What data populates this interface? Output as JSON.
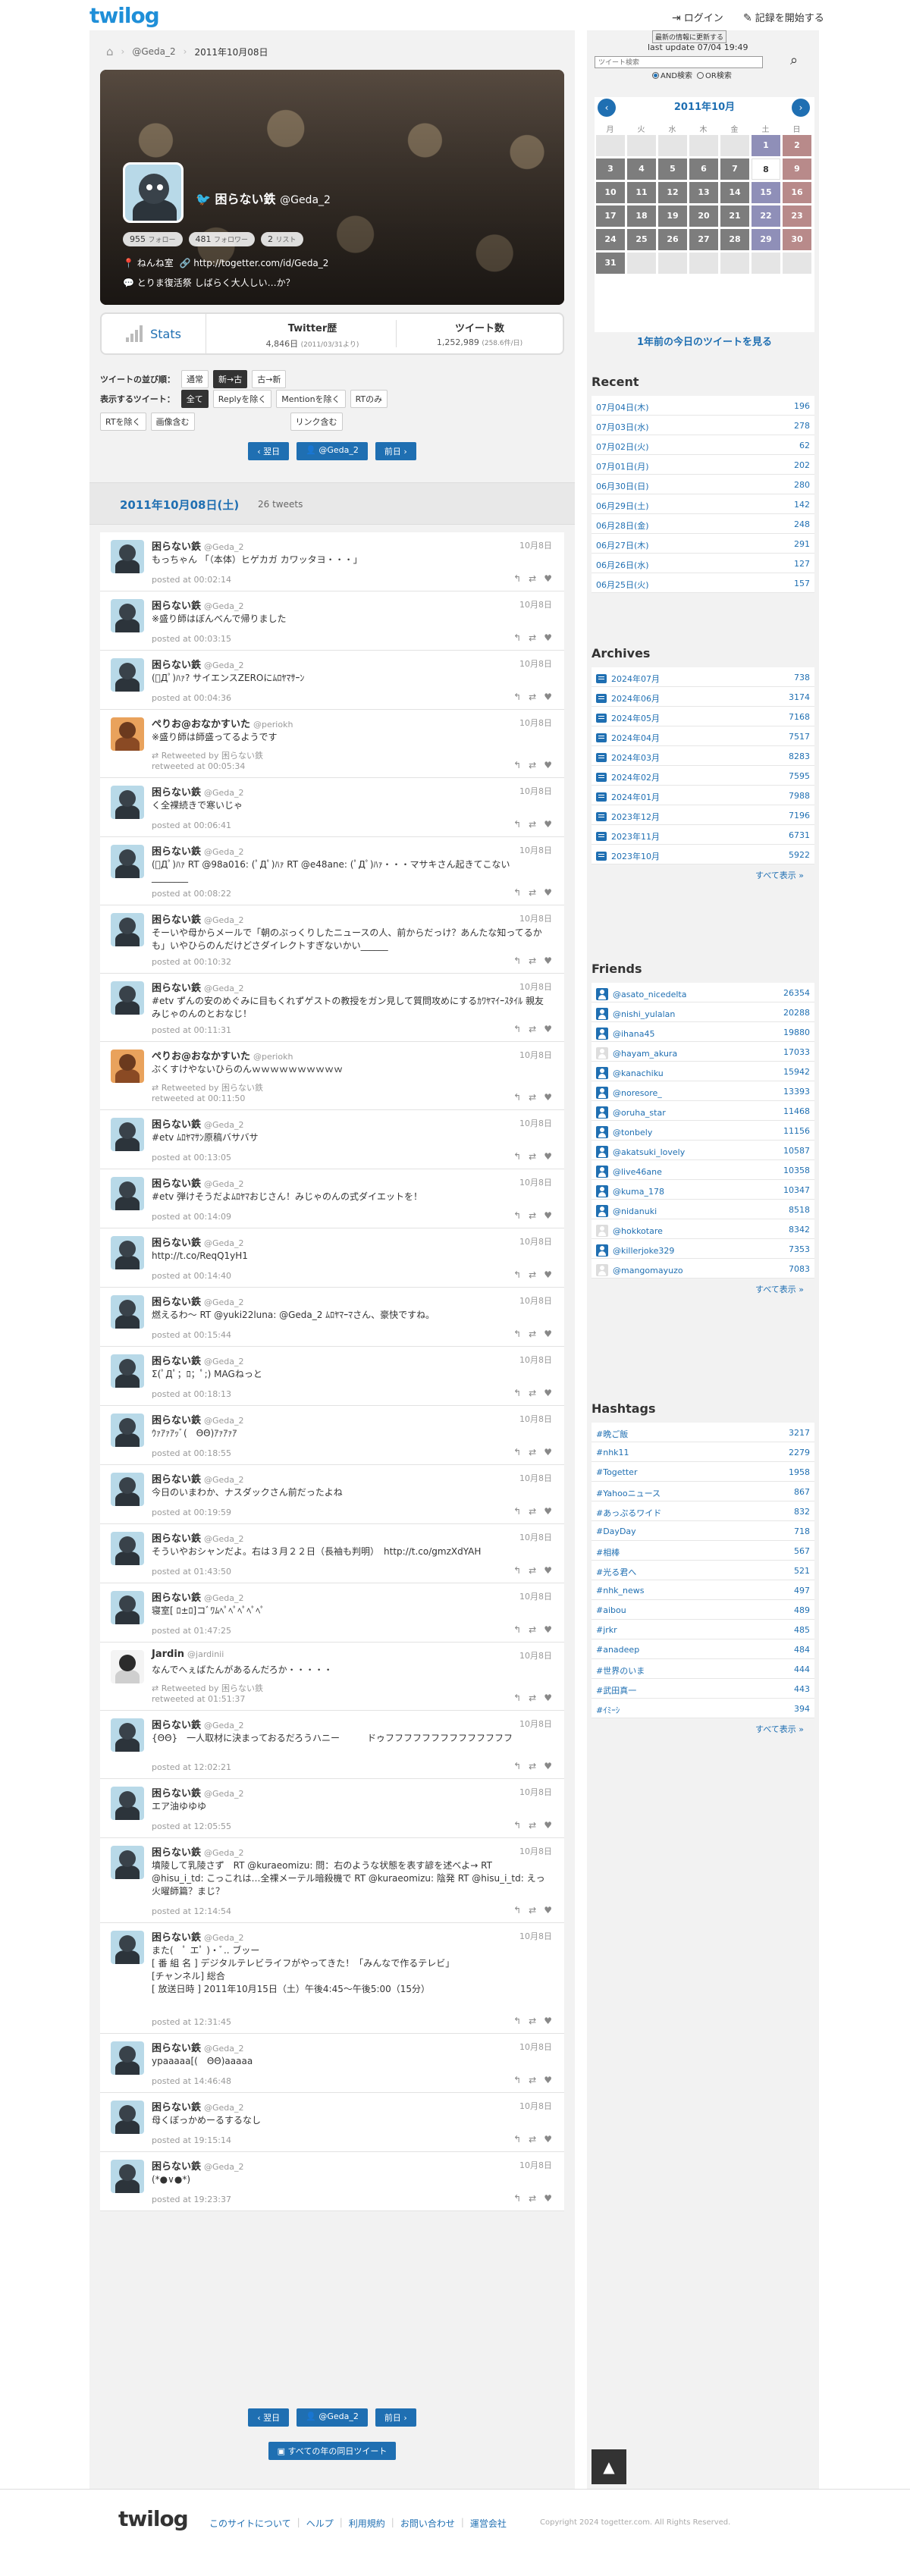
{
  "header": {
    "logo": "twilog",
    "login": "ログイン",
    "start": "記録を開始する"
  },
  "breadcrumb": {
    "user": "@Geda_2",
    "date": "2011年10月08日"
  },
  "profile": {
    "name": "困らない鉄",
    "handle": "@Geda_2",
    "following": "955",
    "following_label": "フォロー",
    "followers": "481",
    "followers_label": "フォロワー",
    "lists": "2",
    "lists_label": "リスト",
    "location": "ねんね室",
    "url": "http://togetter.com/id/Geda_2",
    "bio": "とりま復活祭 しばらく大人しい…か？"
  },
  "stats": {
    "label": "Stats",
    "history_label": "Twitter歴",
    "history_value": "4,846日",
    "history_sub": "(2011/03/31より)",
    "count_label": "ツイート数",
    "count_value": "1,252,989",
    "count_sub": "(258.6件/日)"
  },
  "options": {
    "order_label": "ツイートの並び順：",
    "order": [
      "通常",
      "新→古",
      "古→新"
    ],
    "filter_label": "表示するツイート：",
    "filter": [
      "全て",
      "Replyを除く",
      "Mentionを除く",
      "RTのみ",
      "RTを除く",
      "画像含む",
      "リンク含む"
    ]
  },
  "pager": {
    "prev": "翌日",
    "user": "@Geda_2",
    "next": "前日"
  },
  "day": {
    "date": "2011年10月08日(土)",
    "count": "26 tweets"
  },
  "tweets": [
    {
      "name": "困らない鉄",
      "handle": "@Geda_2",
      "date": "10月8日",
      "text": "もっちゃん 「（本体）ヒゲカガ カワッタヨ・・・」",
      "meta": "posted at 00:02:14",
      "av": "blue"
    },
    {
      "name": "困らない鉄",
      "handle": "@Geda_2",
      "date": "10月8日",
      "text": "※盛り師はぼんべんで帰りました",
      "meta": "posted at 00:03:15",
      "av": "blue"
    },
    {
      "name": "困らない鉄",
      "handle": "@Geda_2",
      "date": "10月8日",
      "text": "(ﾟДﾟ)ﾊｧ? サイエンスZEROにﾑﾛﾔﾏｻｰﾝ",
      "meta": "posted at 00:04:36",
      "av": "blue"
    },
    {
      "name": "ぺりお@おなかすいた",
      "handle": "@periokh",
      "date": "10月8日",
      "text": "※盛り師は師盛ってるようです",
      "rt": "Retweeted by 困らない鉄",
      "meta": "retweeted at 00:05:34",
      "av": "orange"
    },
    {
      "name": "困らない鉄",
      "handle": "@Geda_2",
      "date": "10月8日",
      "text": "く全裸続きで寒いじゃ",
      "meta": "posted at 00:06:41",
      "av": "blue"
    },
    {
      "name": "困らない鉄",
      "handle": "@Geda_2",
      "date": "10月8日",
      "text": "(ﾟДﾟ)ﾊｧ RT @98a016: (ﾟДﾟ)ﾊｧ RT @e48ane: (ﾟДﾟ)ﾊｧ・・・マサキさん起きてこない________",
      "meta": "posted at 00:08:22",
      "av": "blue"
    },
    {
      "name": "困らない鉄",
      "handle": "@Geda_2",
      "date": "10月8日",
      "text": "そーいや母からメールで「朝のぷっくりしたニュースの人、前からだっけ？あんたな知ってるかも」いやひらのんだけどさダイレクトすぎないかい______",
      "meta": "posted at 00:10:32",
      "av": "blue"
    },
    {
      "name": "困らない鉄",
      "handle": "@Geda_2",
      "date": "10月8日",
      "text": "#etv ずんの安のめぐみに目もくれずゲストの教授をガン見して質問攻めにするｶﾜﾔﾏｲｰｽﾀｲﾙ 親友みじゃのんのとおなじ！",
      "meta": "posted at 00:11:31",
      "av": "blue"
    },
    {
      "name": "ぺりお@おなかすいた",
      "handle": "@periokh",
      "date": "10月8日",
      "text": "ぶくすけやないひらのんｗｗｗｗｗｗｗｗｗｗ",
      "rt": "Retweeted by 困らない鉄",
      "meta": "retweeted at 00:11:50",
      "av": "orange"
    },
    {
      "name": "困らない鉄",
      "handle": "@Geda_2",
      "date": "10月8日",
      "text": "#etv ﾑﾛﾔﾏｻﾝ原稿バサバサ",
      "meta": "posted at 00:13:05",
      "av": "blue"
    },
    {
      "name": "困らない鉄",
      "handle": "@Geda_2",
      "date": "10月8日",
      "text": "#etv 弾けそうだよﾑﾛﾔﾏおじさん！みじゃのんの式ダイエットを！",
      "meta": "posted at 00:14:09",
      "av": "blue"
    },
    {
      "name": "困らない鉄",
      "handle": "@Geda_2",
      "date": "10月8日",
      "text": "http://t.co/ReqQ1yH1",
      "meta": "posted at 00:14:40",
      "av": "blue"
    },
    {
      "name": "困らない鉄",
      "handle": "@Geda_2",
      "date": "10月8日",
      "text": "燃えるわ～ RT @yuki22luna: @Geda_2 ﾑﾛﾔﾏｰﾏさん、豪快ですね。",
      "meta": "posted at 00:15:44",
      "av": "blue"
    },
    {
      "name": "困らない鉄",
      "handle": "@Geda_2",
      "date": "10月8日",
      "text": "Σ(ﾟДﾟ；ﾛ；ﾟ;) MAGねっと",
      "meta": "posted at 00:18:13",
      "av": "blue"
    },
    {
      "name": "困らない鉄",
      "handle": "@Geda_2",
      "date": "10月8日",
      "text": "ｳｧｱｧｱｯﾞ(　ΘΘ)ｱｧｱｧｱ",
      "meta": "posted at 00:18:55",
      "av": "blue"
    },
    {
      "name": "困らない鉄",
      "handle": "@Geda_2",
      "date": "10月8日",
      "text": "今日のいまわか、ナスダックさん前だったよね",
      "meta": "posted at 00:19:59",
      "av": "blue"
    },
    {
      "name": "困らない鉄",
      "handle": "@Geda_2",
      "date": "10月8日",
      "text": "そういやおシャンだよ。右は３月２２日（長袖も判明）　http://t.co/gmzXdYAH",
      "meta": "posted at 01:43:50",
      "av": "blue"
    },
    {
      "name": "困らない鉄",
      "handle": "@Geda_2",
      "date": "10月8日",
      "text": "寝室[ ﾛ±ﾛ]コﾞﾜﾑﾍﾟﾍﾟﾍﾟﾍﾟﾍﾟ",
      "meta": "posted at 01:47:25",
      "av": "blue"
    },
    {
      "name": "Jardin",
      "handle": "@jardinii",
      "date": "10月8日",
      "text": "なんでへぇばたんがあるんだろか・・・・・",
      "rt": "Retweeted by 困らない鉄",
      "meta": "retweeted at 01:51:37",
      "av": "white"
    },
    {
      "name": "困らない鉄",
      "handle": "@Geda_2",
      "date": "10月8日",
      "text": "{ΘΘ}　一人取材に決まっておるだろうハニー　　　ドゥフフフフフフフフフフフフフフ",
      "meta": "posted at 12:02:21",
      "av": "blue"
    },
    {
      "name": "困らない鉄",
      "handle": "@Geda_2",
      "date": "10月8日",
      "text": "エア油ゆゆゆ",
      "meta": "posted at 12:05:55",
      "av": "blue"
    },
    {
      "name": "困らない鉄",
      "handle": "@Geda_2",
      "date": "10月8日",
      "text": "墳陵して乳陵さず　RT @kuraeomizu: 問：右のような状態を表す諺を述べよ→ RT @hisu_i_td: こっこれは…全裸メーテル暗殺機で RT @kuraeomizu: 陰発 RT @hisu_i_td: えっ火曜師篇？まじ？",
      "meta": "posted at 12:14:54",
      "av": "blue"
    },
    {
      "name": "困らない鉄",
      "handle": "@Geda_2",
      "date": "10月8日",
      "text": "また(　ﾟ エﾟ )・ﾞ.. ブッー\n[ 番 組 名 ] デジタルテレビライフがやってきた！「みんなで作るテレビ」\n[チャンネル] 総合\n[ 放送日時 ] 2011年10月15日（土）午後4:45～午後5:00（15分）",
      "meta": "posted at 12:31:45",
      "av": "blue"
    },
    {
      "name": "困らない鉄",
      "handle": "@Geda_2",
      "date": "10月8日",
      "text": "ypaaaaa[(　ΘΘ)aaaaa",
      "meta": "posted at 14:46:48",
      "av": "blue"
    },
    {
      "name": "困らない鉄",
      "handle": "@Geda_2",
      "date": "10月8日",
      "text": "母くぼっかめーるするなし",
      "meta": "posted at 19:15:14",
      "av": "blue"
    },
    {
      "name": "困らない鉄",
      "handle": "@Geda_2",
      "date": "10月8日",
      "text": "(*●∨●*)",
      "meta": "posted at 19:23:37",
      "av": "blue"
    }
  ],
  "all_years": "すべての年の同日ツイート",
  "sidebar": {
    "update_btn": "最新の情報に更新する",
    "last_update": "last update 07/04 19:49",
    "search_placeholder": "ツイート検索",
    "and": "AND検索",
    "or": "OR検索",
    "cal_title": "2011年10月",
    "weekdays": [
      "月",
      "火",
      "水",
      "木",
      "金",
      "土",
      "日"
    ],
    "days": [
      "",
      "",
      "",
      "",
      "",
      "1",
      "2",
      "3",
      "4",
      "5",
      "6",
      "7",
      "8",
      "9",
      "10",
      "11",
      "12",
      "13",
      "14",
      "15",
      "16",
      "17",
      "18",
      "19",
      "20",
      "21",
      "22",
      "23",
      "24",
      "25",
      "26",
      "27",
      "28",
      "29",
      "30",
      "31",
      "",
      "",
      "",
      "",
      "",
      ""
    ],
    "year_ago": "1年前の今日のツイートを見る",
    "recent_title": "Recent",
    "recent": [
      {
        "d": "07月04日(木)",
        "n": "196"
      },
      {
        "d": "07月03日(水)",
        "n": "278"
      },
      {
        "d": "07月02日(火)",
        "n": "62"
      },
      {
        "d": "07月01日(月)",
        "n": "202"
      },
      {
        "d": "06月30日(日)",
        "n": "280"
      },
      {
        "d": "06月29日(土)",
        "n": "142"
      },
      {
        "d": "06月28日(金)",
        "n": "248"
      },
      {
        "d": "06月27日(木)",
        "n": "291"
      },
      {
        "d": "06月26日(水)",
        "n": "127"
      },
      {
        "d": "06月25日(火)",
        "n": "157"
      }
    ],
    "archives_title": "Archives",
    "archives": [
      {
        "d": "2024年07月",
        "n": "738"
      },
      {
        "d": "2024年06月",
        "n": "3174"
      },
      {
        "d": "2024年05月",
        "n": "7168"
      },
      {
        "d": "2024年04月",
        "n": "7517"
      },
      {
        "d": "2024年03月",
        "n": "8283"
      },
      {
        "d": "2024年02月",
        "n": "7595"
      },
      {
        "d": "2024年01月",
        "n": "7988"
      },
      {
        "d": "2023年12月",
        "n": "7196"
      },
      {
        "d": "2023年11月",
        "n": "6731"
      },
      {
        "d": "2023年10月",
        "n": "5922"
      }
    ],
    "more": "すべて表示 »",
    "friends_title": "Friends",
    "friends": [
      {
        "d": "@asato_nicedelta",
        "n": "26354",
        "img": false
      },
      {
        "d": "@nishi_yulalan",
        "n": "20288",
        "img": false
      },
      {
        "d": "@ihana45",
        "n": "19880",
        "img": false
      },
      {
        "d": "@hayam_akura",
        "n": "17033",
        "img": true
      },
      {
        "d": "@kanachiku",
        "n": "15942",
        "img": false
      },
      {
        "d": "@noresore_",
        "n": "13393",
        "img": false
      },
      {
        "d": "@oruha_star",
        "n": "11468",
        "img": false
      },
      {
        "d": "@tonbely",
        "n": "11156",
        "img": false
      },
      {
        "d": "@akatsuki_lovely",
        "n": "10587",
        "img": false
      },
      {
        "d": "@live46ane",
        "n": "10358",
        "img": false
      },
      {
        "d": "@kuma_178",
        "n": "10347",
        "img": false
      },
      {
        "d": "@nidanuki",
        "n": "8518",
        "img": false
      },
      {
        "d": "@hokkotare",
        "n": "8342",
        "img": true
      },
      {
        "d": "@killerjoke329",
        "n": "7353",
        "img": false
      },
      {
        "d": "@mangomayuzo",
        "n": "7083",
        "img": true
      }
    ],
    "hashtags_title": "Hashtags",
    "hashtags": [
      {
        "d": "#晩ご飯",
        "n": "3217"
      },
      {
        "d": "#nhk11",
        "n": "2279"
      },
      {
        "d": "#Togetter",
        "n": "1958"
      },
      {
        "d": "#Yahooニュース",
        "n": "867"
      },
      {
        "d": "#あっぷるワイド",
        "n": "832"
      },
      {
        "d": "#DayDay",
        "n": "718"
      },
      {
        "d": "#相棒",
        "n": "567"
      },
      {
        "d": "#光る君へ",
        "n": "521"
      },
      {
        "d": "#nhk_news",
        "n": "497"
      },
      {
        "d": "#aibou",
        "n": "489"
      },
      {
        "d": "#jrkr",
        "n": "485"
      },
      {
        "d": "#anadeep",
        "n": "484"
      },
      {
        "d": "#世界のいま",
        "n": "444"
      },
      {
        "d": "#武田真一",
        "n": "443"
      },
      {
        "d": "#ｲﾐｰｼ",
        "n": "394"
      }
    ]
  },
  "footer": {
    "logo": "twilog",
    "links": [
      "このサイトについて",
      "ヘルプ",
      "利用規約",
      "お問い合わせ",
      "運営会社"
    ],
    "copyright": "Copyright 2024 togetter.com. All Rights Reserved."
  }
}
